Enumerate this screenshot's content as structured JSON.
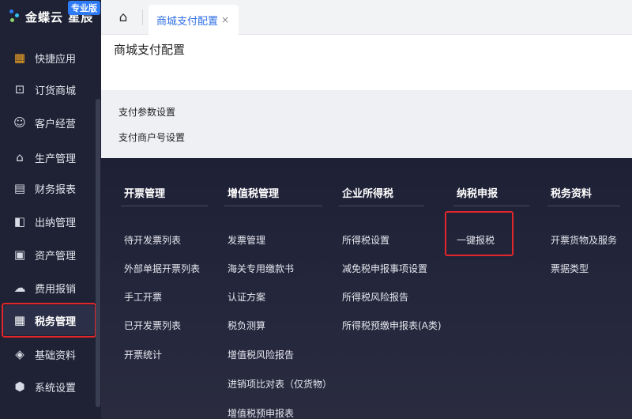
{
  "logo": {
    "name": "金蝶云 星辰",
    "badge": "专业版",
    "colors": [
      "#2f7bf5",
      "#31c4f3",
      "#8dd46a"
    ]
  },
  "sidebar": {
    "items": [
      {
        "label": "快捷应用",
        "icon": "grid-apps-icon",
        "glyph": "▦",
        "color": "#f5a623"
      },
      {
        "label": "订货商城",
        "icon": "shopping-bag-icon",
        "glyph": "⊡",
        "color": "#d8dbe6"
      },
      {
        "label": "客户经营",
        "icon": "user-icon",
        "glyph": "☺",
        "color": "#d8dbe6"
      },
      {
        "label": "生产管理",
        "icon": "factory-icon",
        "glyph": "⌂",
        "color": "#d8dbe6"
      },
      {
        "label": "财务报表",
        "icon": "report-icon",
        "glyph": "▤",
        "color": "#d8dbe6"
      },
      {
        "label": "出纳管理",
        "icon": "cashier-icon",
        "glyph": "◧",
        "color": "#d8dbe6"
      },
      {
        "label": "资产管理",
        "icon": "asset-icon",
        "glyph": "▣",
        "color": "#d8dbe6"
      },
      {
        "label": "费用报销",
        "icon": "cloud-icon",
        "glyph": "☁",
        "color": "#d8dbe6"
      },
      {
        "label": "税务管理",
        "icon": "tax-icon",
        "glyph": "▦",
        "color": "#ffffff",
        "active": true
      },
      {
        "label": "基础资料",
        "icon": "layers-icon",
        "glyph": "◈",
        "color": "#d8dbe6"
      },
      {
        "label": "系统设置",
        "icon": "gear-icon",
        "glyph": "⬢",
        "color": "#d8dbe6"
      }
    ]
  },
  "tabs": {
    "home_icon": "home-icon",
    "home_glyph": "⌂",
    "active_tab": "商城支付配置",
    "close_glyph": "×"
  },
  "page": {
    "title": "商城支付配置",
    "config_items": [
      "支付参数设置",
      "支付商户号设置"
    ]
  },
  "menu": {
    "columns": [
      {
        "header": "开票管理",
        "items": [
          "待开发票列表",
          "外部单据开票列表",
          "手工开票",
          "已开发票列表",
          "开票统计"
        ]
      },
      {
        "header": "增值税管理",
        "items": [
          "发票管理",
          "海关专用缴款书",
          "认证方案",
          "税负测算",
          "增值税风险报告",
          "进销项比对表（仅货物）",
          "增值税预申报表"
        ]
      },
      {
        "header": "企业所得税",
        "items": [
          "所得税设置",
          "减免税申报事项设置",
          "所得税风险报告",
          "所得税预缴申报表(A类)"
        ]
      },
      {
        "header": "纳税申报",
        "items": [
          "一键报税"
        ]
      },
      {
        "header": "税务资料",
        "items": [
          "开票货物及服务",
          "票据类型"
        ]
      }
    ]
  },
  "colors": {
    "accent": "#2f6fe4",
    "highlight": "#e3262a",
    "sidebar_bg": "#1f2234",
    "menu_bg": "#1e2136"
  }
}
